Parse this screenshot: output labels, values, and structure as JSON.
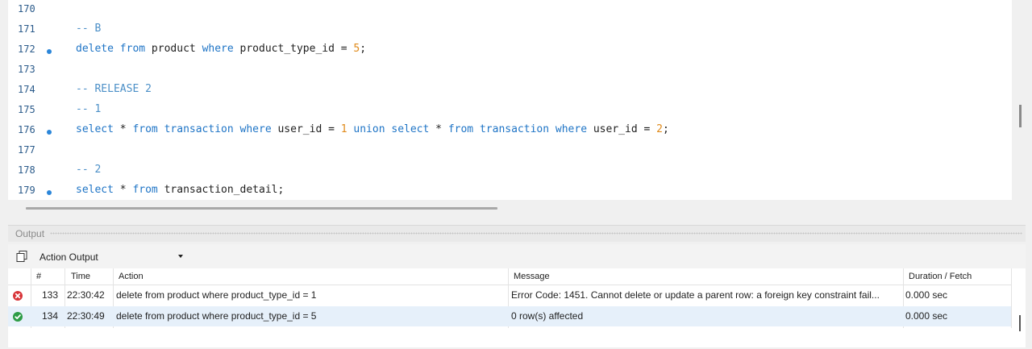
{
  "editor": {
    "lines": [
      {
        "num": "170",
        "dot": false,
        "tokens": []
      },
      {
        "num": "171",
        "dot": false,
        "tokens": [
          {
            "t": "-- B",
            "c": "cm"
          }
        ]
      },
      {
        "num": "172",
        "dot": true,
        "tokens": [
          {
            "t": "delete",
            "c": "kw"
          },
          {
            "t": " "
          },
          {
            "t": "from",
            "c": "kw"
          },
          {
            "t": " product "
          },
          {
            "t": "where",
            "c": "kw"
          },
          {
            "t": " product_type_id = "
          },
          {
            "t": "5",
            "c": "num"
          },
          {
            "t": ";"
          }
        ]
      },
      {
        "num": "173",
        "dot": false,
        "tokens": []
      },
      {
        "num": "174",
        "dot": false,
        "tokens": [
          {
            "t": "-- RELEASE 2",
            "c": "cm"
          }
        ]
      },
      {
        "num": "175",
        "dot": false,
        "tokens": [
          {
            "t": "-- 1",
            "c": "cm"
          }
        ]
      },
      {
        "num": "176",
        "dot": true,
        "tokens": [
          {
            "t": "select",
            "c": "kw"
          },
          {
            "t": " * "
          },
          {
            "t": "from",
            "c": "kw"
          },
          {
            "t": " "
          },
          {
            "t": "transaction",
            "c": "kw"
          },
          {
            "t": " "
          },
          {
            "t": "where",
            "c": "kw"
          },
          {
            "t": " user_id = "
          },
          {
            "t": "1",
            "c": "num"
          },
          {
            "t": " "
          },
          {
            "t": "union",
            "c": "kw"
          },
          {
            "t": " "
          },
          {
            "t": "select",
            "c": "kw"
          },
          {
            "t": " * "
          },
          {
            "t": "from",
            "c": "kw"
          },
          {
            "t": " "
          },
          {
            "t": "transaction",
            "c": "kw"
          },
          {
            "t": " "
          },
          {
            "t": "where",
            "c": "kw"
          },
          {
            "t": " user_id = "
          },
          {
            "t": "2",
            "c": "num"
          },
          {
            "t": ";"
          }
        ]
      },
      {
        "num": "177",
        "dot": false,
        "tokens": []
      },
      {
        "num": "178",
        "dot": false,
        "tokens": [
          {
            "t": "-- 2",
            "c": "cm"
          }
        ]
      },
      {
        "num": "179",
        "dot": true,
        "tokens": [
          {
            "t": "select",
            "c": "kw"
          },
          {
            "t": " * "
          },
          {
            "t": "from",
            "c": "kw"
          },
          {
            "t": " transaction_detail;"
          }
        ]
      }
    ]
  },
  "output": {
    "title": "Output",
    "dropdown_value": "Action Output",
    "columns": {
      "num": "#",
      "time": "Time",
      "action": "Action",
      "message": "Message",
      "duration": "Duration / Fetch"
    },
    "rows": [
      {
        "status": "error",
        "num": "133",
        "time": "22:30:42",
        "action": "delete from product where product_type_id = 1",
        "message": "Error Code: 1451. Cannot delete or update a parent row: a foreign key constraint fail...",
        "duration": "0.000 sec"
      },
      {
        "status": "success",
        "num": "134",
        "time": "22:30:49",
        "action": "delete from product where product_type_id = 5",
        "message": "0 row(s) affected",
        "duration": "0.000 sec"
      }
    ]
  },
  "colors": {
    "keyword": "#1e74c6",
    "comment": "#4b8fc7",
    "number": "#e08a1a",
    "error": "#d8363a",
    "success": "#2e9c46",
    "selected_row": "#e6f0fa"
  }
}
